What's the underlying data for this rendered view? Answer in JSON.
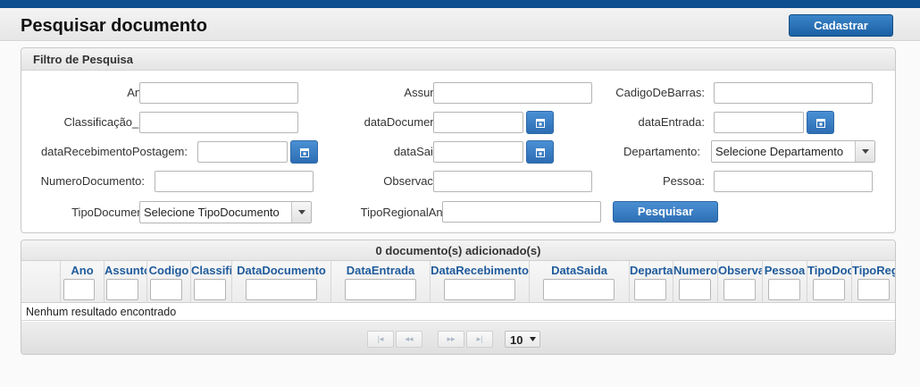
{
  "header": {
    "title": "Pesquisar documento",
    "register_label": "Cadastrar"
  },
  "filter": {
    "title": "Filtro de Pesquisa",
    "labels": {
      "ano": "Ano:",
      "assunto": "Assunto:",
      "codigo_barras": "CadigoDeBarras:",
      "classificacao": "Classificação_id:",
      "data_documento": "dataDocumento:",
      "data_entrada": "dataEntrada:",
      "data_recebimento": "dataRecebimentoPostagem:",
      "data_saida": "dataSaida:",
      "departamento": "Departamento:",
      "numero_documento": "NumeroDocumento:",
      "observacao": "Observacao:",
      "pessoa": "Pessoa:",
      "tipo_documento": "TipoDocumento:",
      "tipo_regional": "TipoRegionalAnfip:"
    },
    "departamento_select": "Selecione Departamento",
    "tipo_documento_select": "Selecione TipoDocumento",
    "search_label": "Pesquisar",
    "icons": {
      "calendar": "calendar-icon",
      "dropdown": "chevron-down-icon"
    }
  },
  "table": {
    "caption": "0 documento(s) adicionado(s)",
    "columns": [
      "Ano",
      "Assunto",
      "Codigo",
      "Classificação",
      "DataDocumento",
      "DataEntrada",
      "DataRecebimento",
      "DataSaida",
      "Departamento",
      "Numero",
      "Observacao",
      "Pessoa",
      "TipoDocumento",
      "TipoRegional"
    ],
    "empty_message": "Nenhum resultado encontrado",
    "paginator": {
      "first": "|◂",
      "prev": "◂◂",
      "next": "▸▸",
      "last": "▸|",
      "rows_per_page": "10"
    }
  },
  "colors": {
    "accent": "#1b5fa3",
    "topbar": "#0d4f8f",
    "header_text": "#1f5b9c"
  }
}
